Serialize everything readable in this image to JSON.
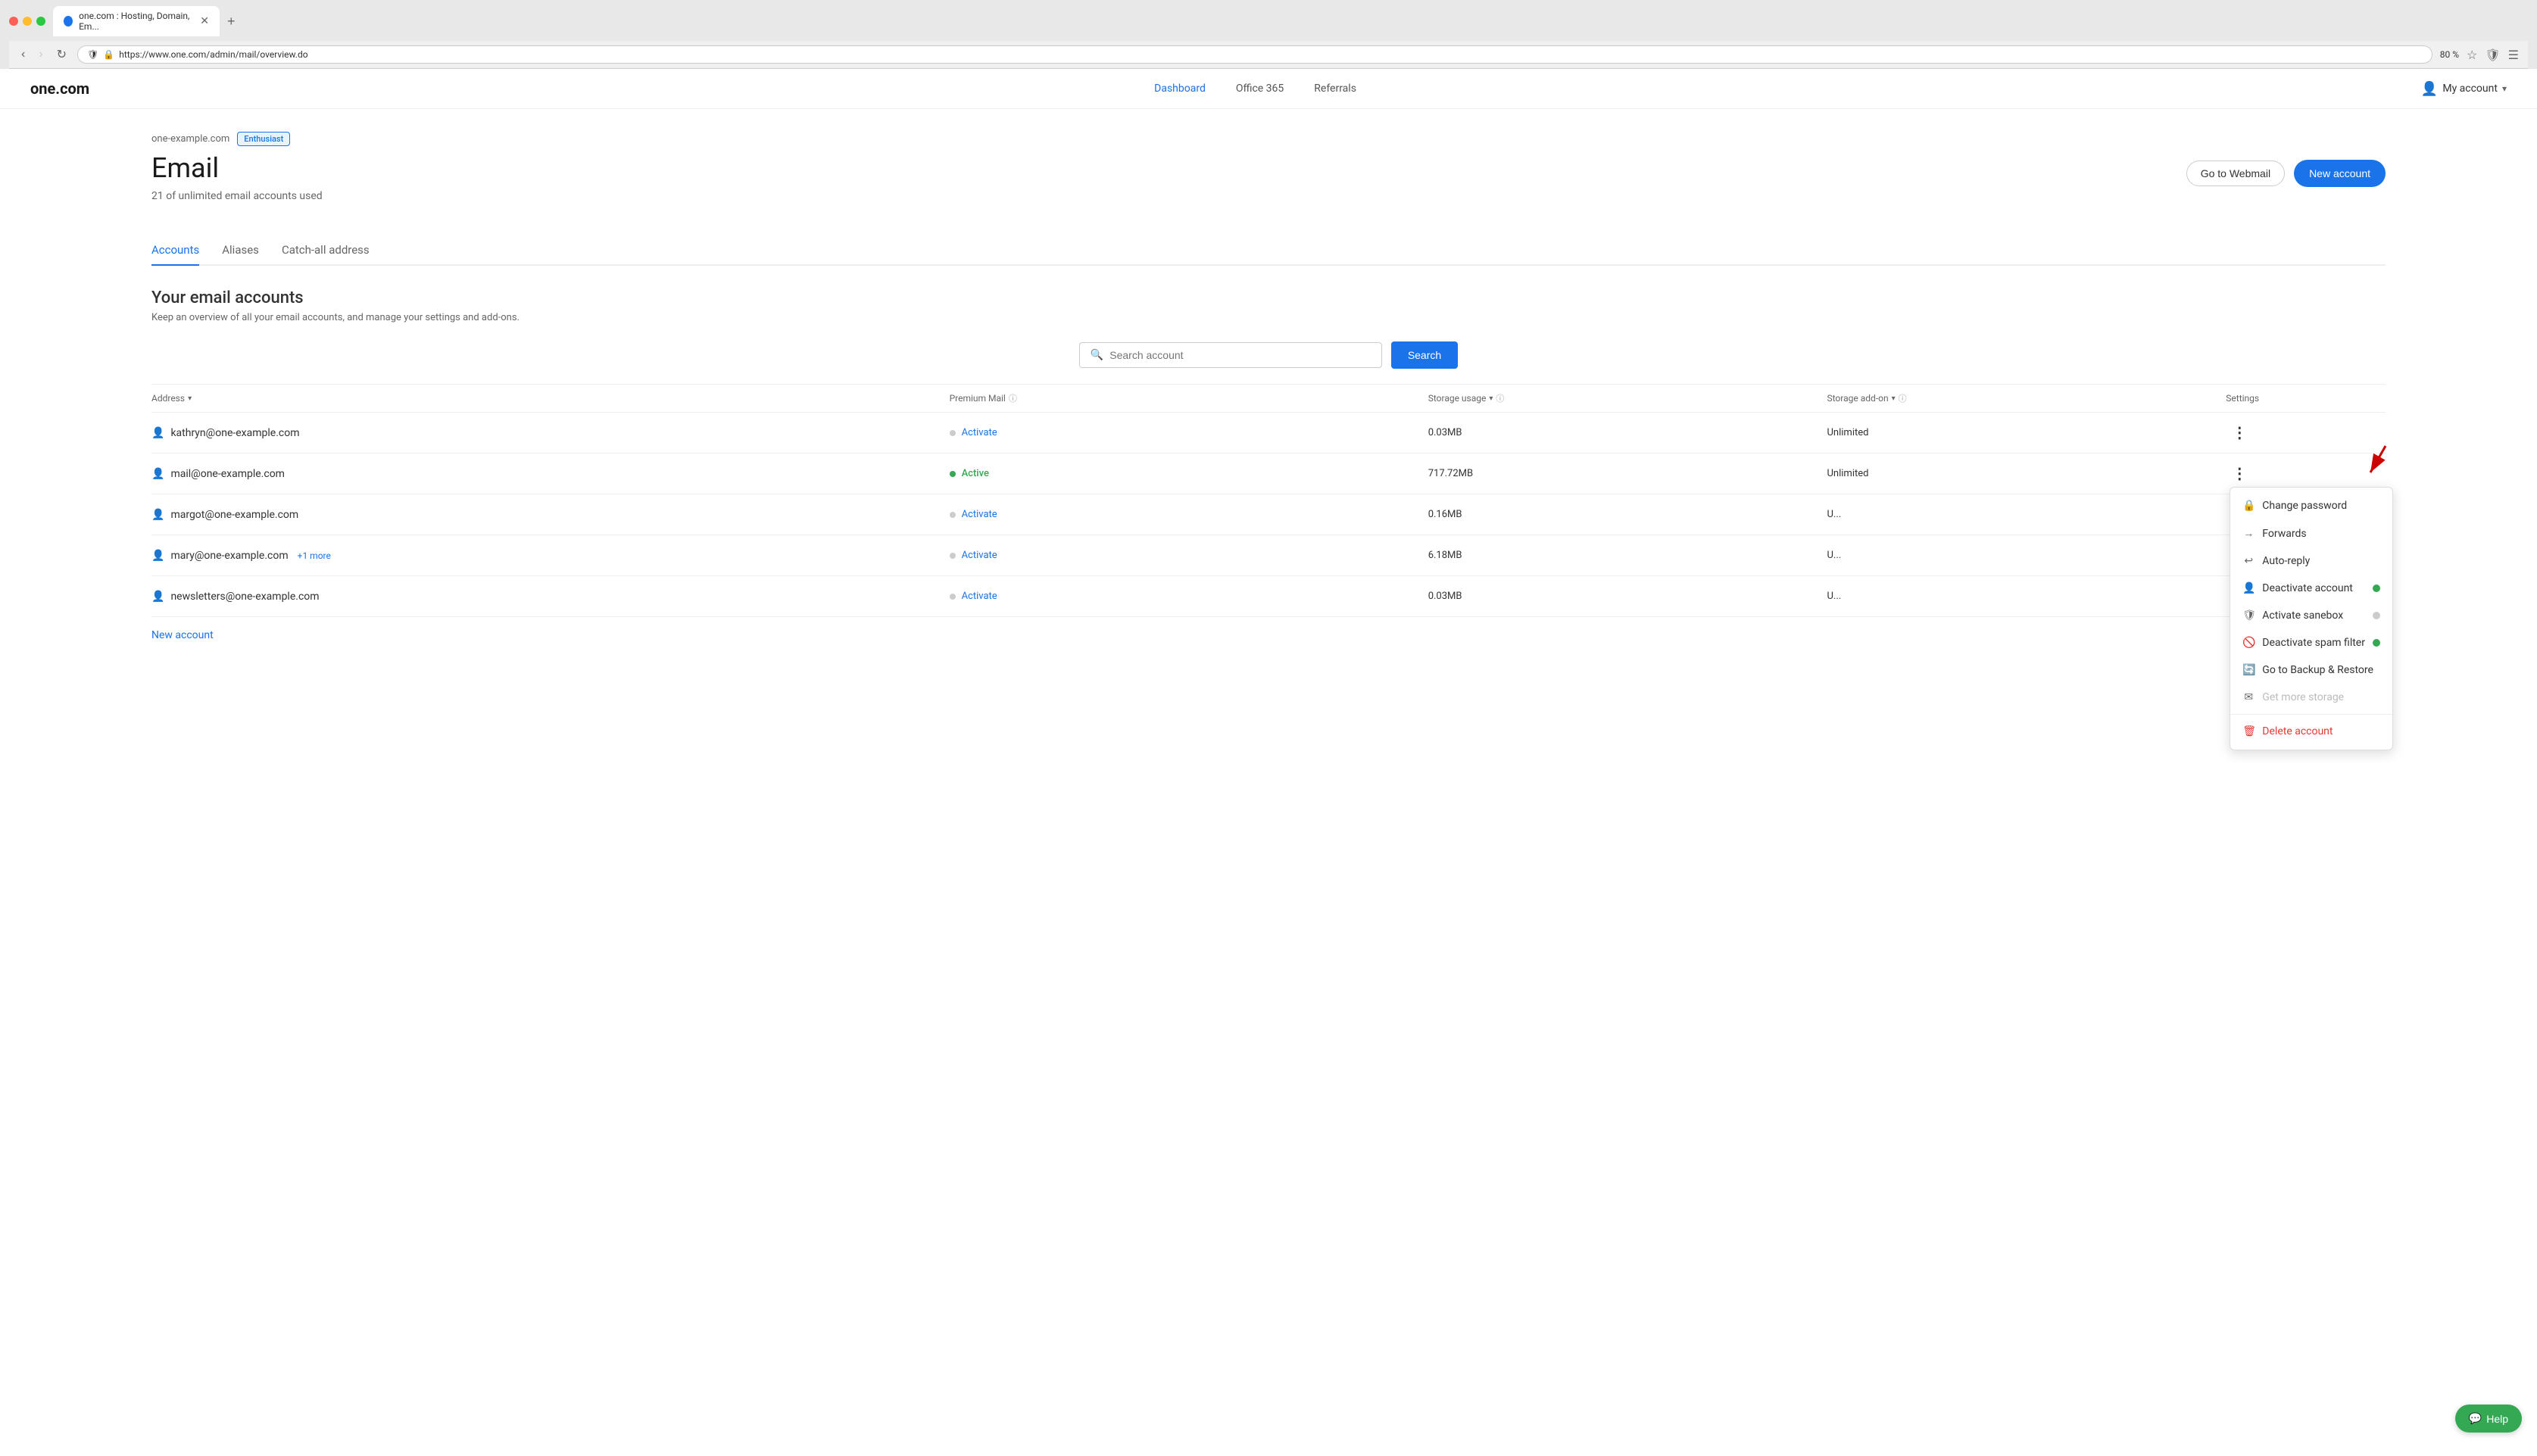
{
  "browser": {
    "tab_title": "one.com : Hosting, Domain, Em...",
    "url": "https://www.one.com/admin/mail/overview.do",
    "zoom": "80 %"
  },
  "nav": {
    "logo": "one.com",
    "links": [
      {
        "label": "Dashboard",
        "active": true
      },
      {
        "label": "Office 365",
        "active": false
      },
      {
        "label": "Referrals",
        "active": false
      }
    ],
    "my_account": "My account"
  },
  "page": {
    "domain": "one-example.com",
    "badge": "Enthusiast",
    "title": "Email",
    "subtitle": "21 of unlimited email accounts used",
    "btn_webmail": "Go to Webmail",
    "btn_new_account": "New account"
  },
  "tabs": [
    {
      "label": "Accounts",
      "active": true
    },
    {
      "label": "Aliases",
      "active": false
    },
    {
      "label": "Catch-all address",
      "active": false
    }
  ],
  "section": {
    "title": "Your email accounts",
    "description": "Keep an overview of all your email accounts, and manage your settings and add-ons."
  },
  "search": {
    "placeholder": "Search account",
    "button": "Search"
  },
  "table": {
    "headers": [
      {
        "label": "Address",
        "sortable": true
      },
      {
        "label": "Premium Mail",
        "info": true
      },
      {
        "label": "Storage usage",
        "sortable": true,
        "info": true
      },
      {
        "label": "Storage add-on",
        "sortable": true,
        "info": true
      },
      {
        "label": "Settings"
      }
    ],
    "rows": [
      {
        "email": "kathryn@one-example.com",
        "premium_status": "Activate",
        "premium_dot": "gray",
        "storage": "0.03MB",
        "addon": "Unlimited",
        "has_menu": false
      },
      {
        "email": "mail@one-example.com",
        "premium_status": "Active",
        "premium_dot": "active",
        "storage": "717.72MB",
        "addon": "Unlimited",
        "has_menu": true,
        "menu_open": true
      },
      {
        "email": "margot@one-example.com",
        "premium_status": "Activate",
        "premium_dot": "gray",
        "storage": "0.16MB",
        "addon": "U...",
        "has_menu": false
      },
      {
        "email": "mary@one-example.com",
        "premium_status": "Activate",
        "premium_dot": "gray",
        "storage": "6.18MB",
        "addon": "U...",
        "has_menu": false,
        "extra": "+1 more"
      },
      {
        "email": "newsletters@one-example.com",
        "premium_status": "Activate",
        "premium_dot": "gray",
        "storage": "0.03MB",
        "addon": "U...",
        "has_menu": false
      }
    ],
    "new_account_link": "New account"
  },
  "dropdown": {
    "items": [
      {
        "icon": "🔒",
        "label": "Change password",
        "type": "normal",
        "has_toggle": false
      },
      {
        "icon": "→",
        "label": "Forwards",
        "type": "normal",
        "has_toggle": false
      },
      {
        "icon": "↩",
        "label": "Auto-reply",
        "type": "normal",
        "has_toggle": false
      },
      {
        "icon": "👤",
        "label": "Deactivate account",
        "type": "normal",
        "has_toggle": true,
        "toggle": "on"
      },
      {
        "icon": "🛡",
        "label": "Activate sanebox",
        "type": "normal",
        "has_toggle": true,
        "toggle": "off"
      },
      {
        "icon": "🚫",
        "label": "Deactivate spam filter",
        "type": "normal",
        "has_toggle": true,
        "toggle": "on"
      },
      {
        "icon": "🔄",
        "label": "Go to Backup & Restore",
        "type": "normal",
        "has_toggle": false
      },
      {
        "icon": "✉",
        "label": "Get more storage",
        "type": "disabled",
        "has_toggle": false
      },
      {
        "icon": "🗑",
        "label": "Delete account",
        "type": "danger",
        "has_toggle": false
      }
    ]
  },
  "help": {
    "label": "Help"
  }
}
